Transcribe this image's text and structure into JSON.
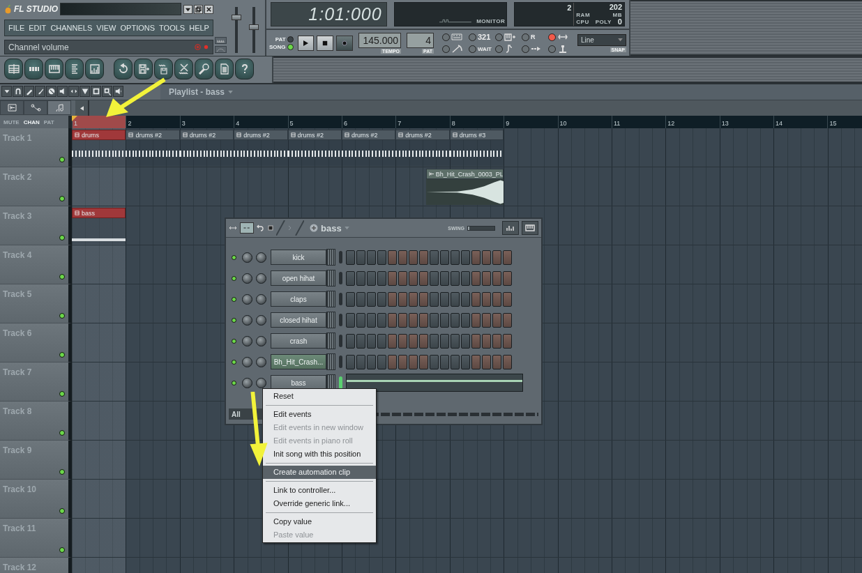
{
  "app": {
    "logo": "FL STUDIO",
    "menu": [
      "FILE",
      "EDIT",
      "CHANNELS",
      "VIEW",
      "OPTIONS",
      "TOOLS",
      "HELP"
    ],
    "hint": "Channel volume",
    "faders": [
      {
        "level": 0.8
      },
      {
        "level": 0.55
      }
    ]
  },
  "transport": {
    "time": "1:01:000",
    "modes": [
      {
        "label": "PAT",
        "selected": false
      },
      {
        "label": "SONG",
        "selected": true
      }
    ],
    "tempo": "145.000",
    "tempo_label": "TEMPO",
    "pattern": "4",
    "pattern_label": "PAT",
    "monitor_label": "MONITOR",
    "stats": {
      "cpu": "2",
      "ram": "202",
      "ram_label": "RAM",
      "mb_label": "MB",
      "cpu_label": "CPU",
      "poly_label": "POLY",
      "poly": "0"
    },
    "options": [
      {
        "kind": "typing",
        "on": false
      },
      {
        "kind": "metronome",
        "on": false
      },
      {
        "kind": "countdown",
        "on": false,
        "label": "321"
      },
      {
        "kind": "wait",
        "on": false,
        "label": "WAIT"
      },
      {
        "kind": "overdub",
        "on": false
      },
      {
        "kind": "step",
        "on": false
      },
      {
        "kind": "filter",
        "on": false,
        "label": "R"
      },
      {
        "kind": "blend",
        "on": false
      },
      {
        "kind": "loop",
        "on": true
      },
      {
        "kind": "joystick",
        "on": false
      }
    ],
    "snap": {
      "value": "Line",
      "label": "SNAP"
    }
  },
  "playlist": {
    "title": "Playlist - bass",
    "tabs": [
      {
        "selected": false
      },
      {
        "selected": false
      },
      {
        "selected": true
      }
    ],
    "view_modes": [
      {
        "label": "MUTE",
        "selected": false
      },
      {
        "label": "CHAN",
        "selected": true
      },
      {
        "label": "PAT",
        "selected": false
      }
    ],
    "bars": [
      {
        "label": "1",
        "selected": true
      },
      {
        "label": "2",
        "selected": false
      },
      {
        "label": "3",
        "selected": false
      },
      {
        "label": "4",
        "selected": false
      },
      {
        "label": "5",
        "selected": false
      },
      {
        "label": "6",
        "selected": false
      },
      {
        "label": "7",
        "selected": false
      },
      {
        "label": "8",
        "selected": false
      },
      {
        "label": "9",
        "selected": false
      },
      {
        "label": "10",
        "selected": false
      },
      {
        "label": "11",
        "selected": false
      },
      {
        "label": "12",
        "selected": false
      },
      {
        "label": "13",
        "selected": false
      },
      {
        "label": "14",
        "selected": false
      },
      {
        "label": "15",
        "selected": false
      }
    ],
    "tracks": [
      {
        "name": "Track 1",
        "on": true,
        "clips": [
          {
            "kind": "steps_pattern",
            "label": "drums",
            "selected": true
          },
          {
            "kind": "steps_pattern",
            "label": "drums #2",
            "selected": false
          },
          {
            "kind": "steps_pattern",
            "label": "drums #2",
            "selected": false
          },
          {
            "kind": "steps_pattern",
            "label": "drums #2",
            "selected": false
          },
          {
            "kind": "steps_pattern",
            "label": "drums #2",
            "selected": false
          },
          {
            "kind": "steps_pattern",
            "label": "drums #2",
            "selected": false
          },
          {
            "kind": "steps_pattern",
            "label": "drums #2",
            "selected": false
          },
          {
            "kind": "steps_pattern",
            "label": "drums #3",
            "selected": false
          }
        ]
      },
      {
        "name": "Track 2",
        "on": true,
        "clips": [
          {
            "kind": "empty"
          },
          {
            "kind": "empty"
          },
          {
            "kind": "empty"
          },
          {
            "kind": "empty"
          },
          {
            "kind": "empty"
          },
          {
            "kind": "empty"
          },
          {
            "kind": "empty"
          },
          {
            "kind": "audio",
            "label": "Bh_Hit_Crash_0003_PL",
            "selected": false
          }
        ]
      },
      {
        "name": "Track 3",
        "on": true,
        "clips": [
          {
            "kind": "line_pattern",
            "label": "bass",
            "selected": true
          }
        ]
      },
      {
        "name": "Track 4",
        "on": true
      },
      {
        "name": "Track 5",
        "on": true
      },
      {
        "name": "Track 6",
        "on": true
      },
      {
        "name": "Track 7",
        "on": true
      },
      {
        "name": "Track 8",
        "on": true
      },
      {
        "name": "Track 9",
        "on": true
      },
      {
        "name": "Track 10",
        "on": true
      },
      {
        "name": "Track 11",
        "on": true
      },
      {
        "name": "Track 12"
      }
    ]
  },
  "channel_rack": {
    "pattern": "bass",
    "swing": {
      "label": "SWING",
      "level": 0.05
    },
    "filter": "All",
    "channels": [
      {
        "name": "kick",
        "on": true,
        "selected": false,
        "focused": false,
        "kind": "steps"
      },
      {
        "name": "open hihat",
        "on": true,
        "selected": false,
        "focused": false,
        "kind": "steps"
      },
      {
        "name": "claps",
        "on": true,
        "selected": false,
        "focused": false,
        "kind": "steps"
      },
      {
        "name": "closed hihat",
        "on": true,
        "selected": false,
        "focused": false,
        "kind": "steps"
      },
      {
        "name": "crash",
        "on": true,
        "selected": false,
        "focused": false,
        "kind": "steps"
      },
      {
        "name": "Bh_Hit_Crash...",
        "on": true,
        "selected": true,
        "focused": false,
        "kind": "steps"
      },
      {
        "name": "bass",
        "on": true,
        "selected": false,
        "focused": true,
        "kind": "pianoroll"
      }
    ]
  },
  "context_menu": {
    "items": [
      {
        "kind": "item",
        "label": "Reset",
        "disabled": false,
        "selected": false
      },
      {
        "kind": "separator"
      },
      {
        "kind": "item",
        "label": "Edit events",
        "disabled": false,
        "selected": false
      },
      {
        "kind": "item",
        "label": "Edit events in new window",
        "disabled": true,
        "selected": false
      },
      {
        "kind": "item",
        "label": "Edit events in piano roll",
        "disabled": true,
        "selected": false
      },
      {
        "kind": "item",
        "label": "Init song with this position",
        "disabled": false,
        "selected": false
      },
      {
        "kind": "separator"
      },
      {
        "kind": "item",
        "label": "Create automation clip",
        "disabled": false,
        "selected": true
      },
      {
        "kind": "separator"
      },
      {
        "kind": "item",
        "label": "Link to controller...",
        "disabled": false,
        "selected": false
      },
      {
        "kind": "item",
        "label": "Override generic link...",
        "disabled": false,
        "selected": false
      },
      {
        "kind": "separator"
      },
      {
        "kind": "item",
        "label": "Copy value",
        "disabled": false,
        "selected": false
      },
      {
        "kind": "item",
        "label": "Paste value",
        "disabled": true,
        "selected": false
      }
    ]
  }
}
